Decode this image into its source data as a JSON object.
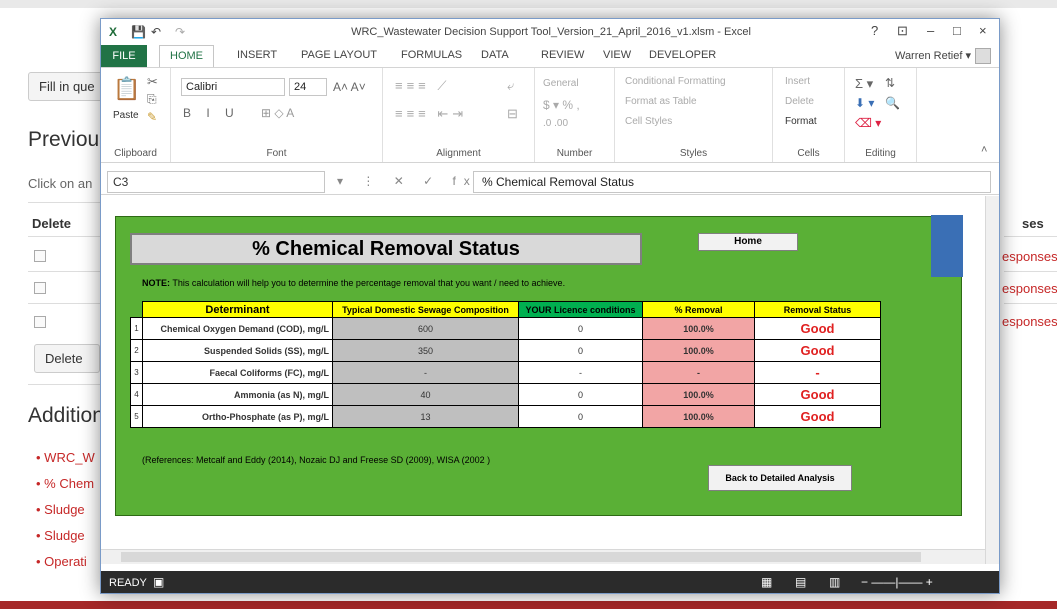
{
  "background_page": {
    "fill_button": "Fill in que",
    "previous_heading": "Previous",
    "click_text": "Click on an",
    "delete_header": "Delete",
    "responses_header": "ses",
    "response_links": [
      "esponses",
      "esponses",
      "esponses"
    ],
    "delete_button": "Delete",
    "additional_heading": "Addition",
    "links": [
      "WRC_W",
      "% Chem",
      "Sludge",
      "Sludge",
      "Operati"
    ]
  },
  "excel": {
    "title": "WRC_Wastewater Decision Support Tool_Version_21_April_2016_v1.xlsm - Excel",
    "window_controls": [
      "?",
      "⊡",
      "–",
      "□",
      "×"
    ],
    "user": "Warren Retief",
    "tabs": [
      "FILE",
      "HOME",
      "INSERT",
      "PAGE LAYOUT",
      "FORMULAS",
      "DATA",
      "REVIEW",
      "VIEW",
      "DEVELOPER"
    ],
    "active_tab": "HOME",
    "ribbon": {
      "paste": "Paste",
      "clipboard": "Clipboard",
      "font_name": "Calibri",
      "font_size": "24",
      "font_label": "Font",
      "alignment_label": "Alignment",
      "number_format": "General",
      "number_label": "Number",
      "conditional_formatting": "Conditional Formatting",
      "format_as_table": "Format as Table",
      "cell_styles": "Cell Styles",
      "styles_label": "Styles",
      "insert": "Insert",
      "delete": "Delete",
      "format": "Format",
      "cells_label": "Cells",
      "editing_label": "Editing"
    },
    "name_box": "C3",
    "formula": "% Chemical Removal Status",
    "status": "READY"
  },
  "dashboard": {
    "title": "% Chemical Removal Status",
    "home_button": "Home",
    "note_bold": "NOTE:",
    "note_text": " This calculation will help you to determine the percentage removal that you want / need to achieve.",
    "headers": {
      "determinant": "Determinant",
      "typical": "Typical Domestic Sewage Composition",
      "licence": "YOUR Licence conditions",
      "removal": "% Removal",
      "status": "Removal Status"
    },
    "rows": [
      {
        "n": "1",
        "det": "Chemical Oxygen Demand (COD), mg/L",
        "typ": "600",
        "lic": "0",
        "rem": "100.0%",
        "sts": "Good"
      },
      {
        "n": "2",
        "det": "Suspended Solids (SS), mg/L",
        "typ": "350",
        "lic": "0",
        "rem": "100.0%",
        "sts": "Good"
      },
      {
        "n": "3",
        "det": "Faecal Coliforms (FC), mg/L",
        "typ": "-",
        "lic": "-",
        "rem": "-",
        "sts": "-"
      },
      {
        "n": "4",
        "det": "Ammonia (as N), mg/L",
        "typ": "40",
        "lic": "0",
        "rem": "100.0%",
        "sts": "Good"
      },
      {
        "n": "5",
        "det": "Ortho-Phosphate (as P), mg/L",
        "typ": "13",
        "lic": "0",
        "rem": "100.0%",
        "sts": "Good"
      }
    ],
    "references": "(References: Metcalf and Eddy (2014), Nozaic DJ and Freese SD (2009), WISA (2002 )",
    "back_button": "Back to Detailed Analysis"
  }
}
